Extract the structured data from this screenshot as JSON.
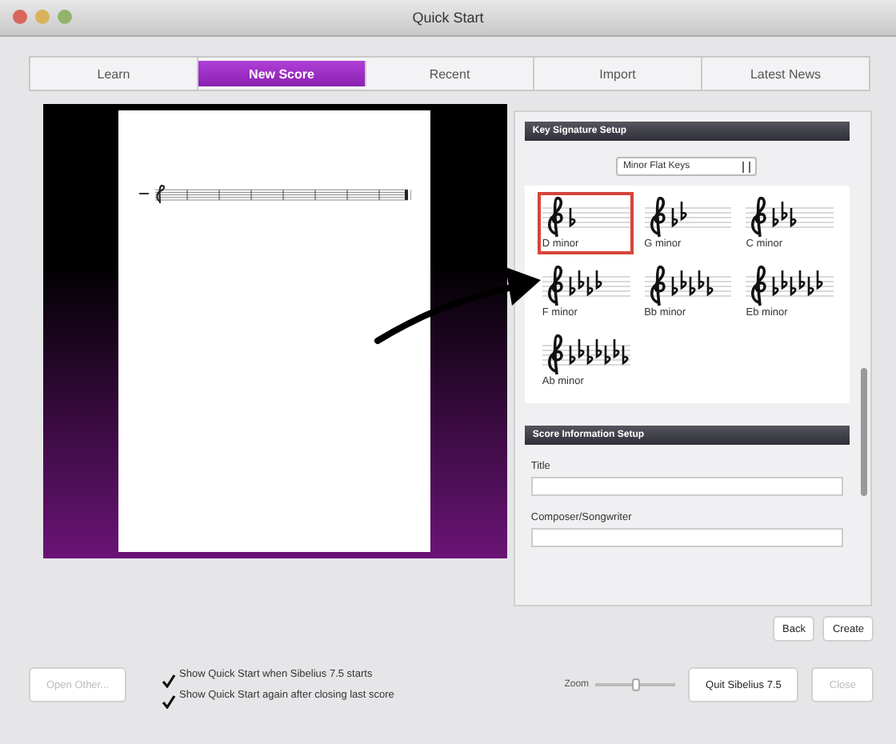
{
  "window": {
    "title": "Quick Start"
  },
  "tabs": [
    {
      "label": "Learn",
      "selected": false
    },
    {
      "label": "New Score",
      "selected": true
    },
    {
      "label": "Recent",
      "selected": false
    },
    {
      "label": "Import",
      "selected": false
    },
    {
      "label": "Latest News",
      "selected": false
    }
  ],
  "key_signature_setup": {
    "heading": "Key Signature Setup",
    "dropdown": "Minor Flat Keys",
    "keys": [
      {
        "label": "D minor",
        "selected": true
      },
      {
        "label": "G minor",
        "selected": false
      },
      {
        "label": "C minor",
        "selected": false
      },
      {
        "label": "F minor",
        "selected": false
      },
      {
        "label": "Bb minor",
        "selected": false
      },
      {
        "label": "Eb minor",
        "selected": false
      },
      {
        "label": "Ab minor",
        "selected": false
      }
    ]
  },
  "score_information_setup": {
    "heading": "Score Information Setup",
    "fields": [
      {
        "label": "Title"
      },
      {
        "label": "Composer/Songwriter"
      }
    ]
  },
  "panel_buttons": [
    {
      "label": "Back",
      "disabled": false
    },
    {
      "label": "Create",
      "disabled": false
    }
  ],
  "footer": {
    "open_button": {
      "label": "Open Other...",
      "disabled": true
    },
    "checkboxes": [
      {
        "label": "Show Quick Start when Sibelius 7.5 starts",
        "checked": true
      },
      {
        "label": "Show Quick Start again after closing last score",
        "checked": true
      }
    ],
    "zoom": {
      "label": "Zoom",
      "level": 0.5
    },
    "buttons": [
      {
        "label": "Quit Sibelius 7.5",
        "disabled": false
      },
      {
        "label": "Close",
        "disabled": true
      }
    ]
  }
}
